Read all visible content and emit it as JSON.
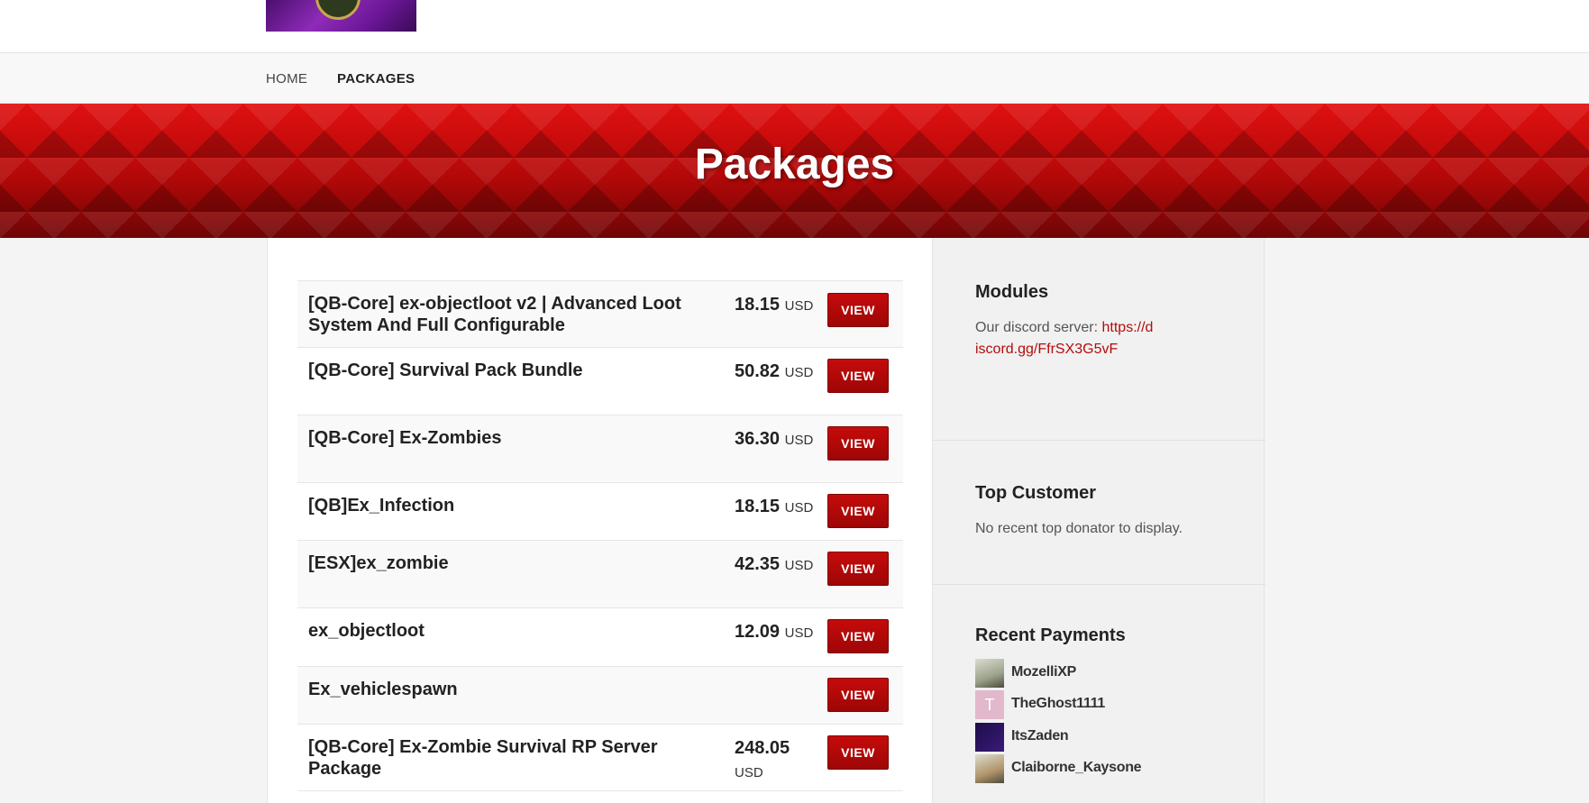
{
  "nav": {
    "home": "HOME",
    "packages": "PACKAGES"
  },
  "banner": {
    "title": "Packages"
  },
  "packages": [
    {
      "name": "[QB-Core] ex-objectloot v2 | Advanced Loot System And Full Configurable",
      "price": "18.15",
      "currency": "USD",
      "button": "VIEW"
    },
    {
      "name": "[QB-Core] Survival Pack Bundle",
      "price": "50.82",
      "currency": "USD",
      "button": "VIEW"
    },
    {
      "name": "[QB-Core] Ex-Zombies",
      "price": "36.30",
      "currency": "USD",
      "button": "VIEW"
    },
    {
      "name": "[QB]Ex_Infection",
      "price": "18.15",
      "currency": "USD",
      "button": "VIEW"
    },
    {
      "name": "[ESX]ex_zombie",
      "price": "42.35",
      "currency": "USD",
      "button": "VIEW"
    },
    {
      "name": "ex_objectloot",
      "price": "12.09",
      "currency": "USD",
      "button": "VIEW"
    },
    {
      "name": "Ex_vehiclespawn",
      "price": "",
      "currency": "",
      "button": "VIEW"
    },
    {
      "name": "[QB-Core] Ex-Zombie Survival RP Server Package",
      "price": "248.05",
      "currency": "USD",
      "button": "VIEW"
    }
  ],
  "sidebar": {
    "modules": {
      "title": "Modules",
      "text": "Our discord server:",
      "link": "https://discord.gg/FfrSX3G5vF"
    },
    "top_customer": {
      "title": "Top Customer",
      "text": "No recent top donator to display."
    },
    "recent_payments": {
      "title": "Recent Payments",
      "items": [
        {
          "name": "MozelliXP",
          "avatar": "photo-avatar",
          "color": "#9aa38a"
        },
        {
          "name": "TheGhost1111",
          "avatar": "letter-avatar",
          "letter": "T",
          "color": "#e2b8cc"
        },
        {
          "name": "ItsZaden",
          "avatar": "logo-avatar",
          "color": "#3a1a78"
        },
        {
          "name": "Claiborne_Kaysone",
          "avatar": "photo-avatar",
          "color": "#b0956a"
        }
      ]
    }
  },
  "colors": {
    "accent": "#b30c0c",
    "button": "#b00808"
  }
}
